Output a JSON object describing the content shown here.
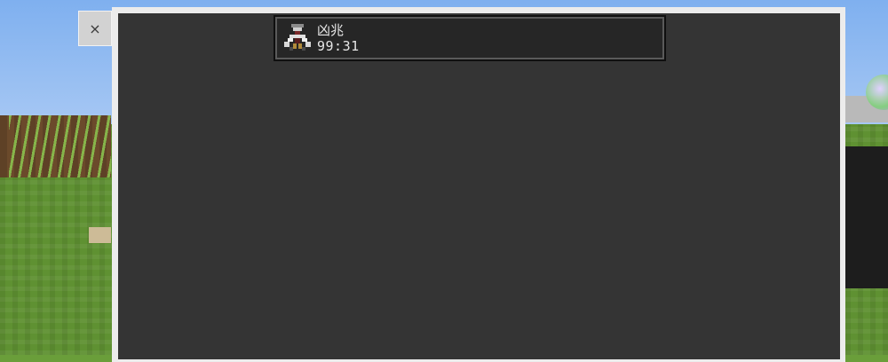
{
  "window": {
    "close_label": "×"
  },
  "entry": {
    "name": "凶兆",
    "time": "99:31",
    "icon": "bad-omen-icon"
  },
  "colors": {
    "panel_background": "#343434",
    "panel_frame": "#ececec",
    "entry_background": "#262626",
    "entry_text": "#e6e6e6"
  }
}
